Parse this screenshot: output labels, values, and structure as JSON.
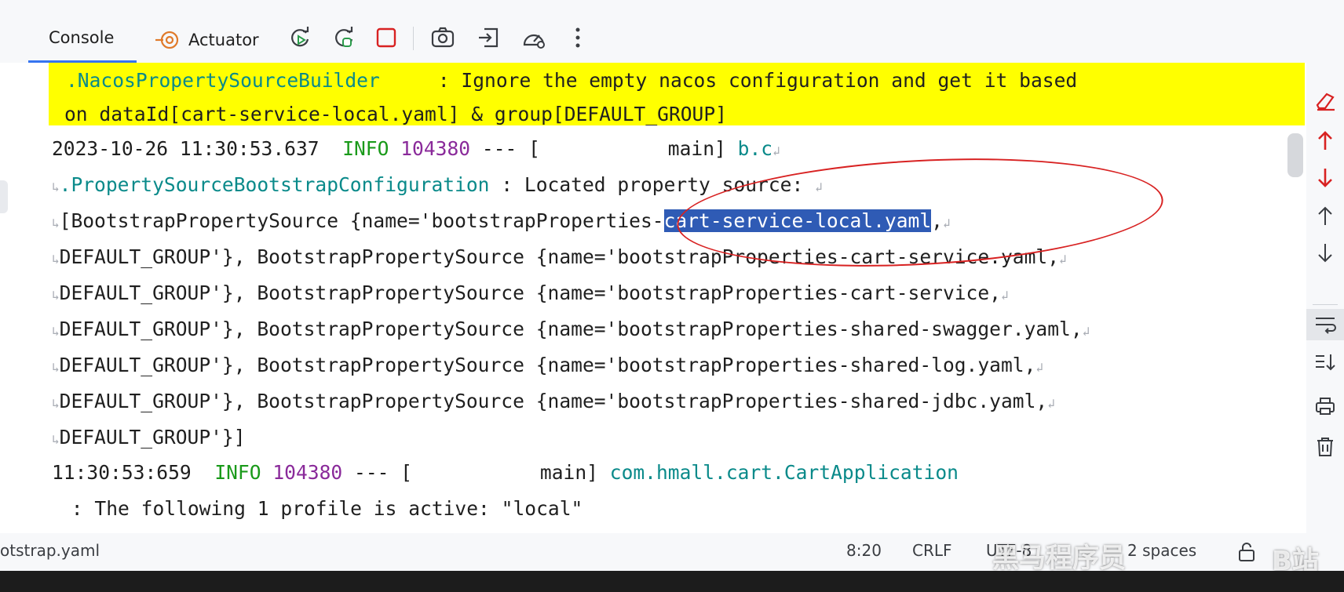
{
  "toolbar": {
    "console_label": "Console",
    "actuator_label": "Actuator"
  },
  "log": {
    "line1": {
      "cls": ".NacosPropertySourceBuilder",
      "msg": "     : Ignore the empty nacos configuration and get it based"
    },
    "line2": "on dataId[cart-service-local.yaml] & group[DEFAULT_GROUP]",
    "line3": {
      "time": "2023-10-26 11:30:53.637",
      "level": "INFO",
      "pid": "104380",
      "thread": " --- [           main] ",
      "cls": "b.c"
    },
    "line4": {
      "cls": ".PropertySourceBootstrapConfiguration",
      "msg": " : Located property source: "
    },
    "line5": {
      "pre": "[BootstrapPropertySource {name='bootstrapProperties-",
      "selected": "cart-service-local.yaml",
      "post": ","
    },
    "line6": "DEFAULT_GROUP'}, BootstrapPropertySource {name='bootstrapProperties-cart-service.yaml,",
    "line7": "DEFAULT_GROUP'}, BootstrapPropertySource {name='bootstrapProperties-cart-service,",
    "line8": "DEFAULT_GROUP'}, BootstrapPropertySource {name='bootstrapProperties-shared-swagger.yaml,",
    "line9": "DEFAULT_GROUP'}, BootstrapPropertySource {name='bootstrapProperties-shared-log.yaml,",
    "line10": "DEFAULT_GROUP'}, BootstrapPropertySource {name='bootstrapProperties-shared-jdbc.yaml,",
    "line11": "DEFAULT_GROUP'}]",
    "line12": {
      "time": "11:30:53:659",
      "level": "INFO",
      "pid": "104380",
      "thread": " --- [           main] ",
      "cls": "com.hmall.cart.CartApplication"
    },
    "line13": " : The following 1 profile is active: \"local\""
  },
  "statusbar": {
    "file": "otstrap.yaml",
    "position": "8:20",
    "line_sep": "CRLF",
    "encoding": "UTF-8",
    "indent": "2 spaces",
    "watermark": "黑马程序员",
    "brand": "B站"
  },
  "colors": {
    "highlight": "#ffff00",
    "selection": "#2f5bb5",
    "annotation": "#d82222",
    "accent": "#3574f0"
  },
  "icons": {
    "actuator": "actuator-icon",
    "rerun": "rerun-icon",
    "rerun_debug": "rerun-debug-icon",
    "stop": "stop-icon",
    "screenshot": "camera-icon",
    "restore": "restore-icon",
    "speed": "gauge-icon",
    "more": "more-icon"
  }
}
